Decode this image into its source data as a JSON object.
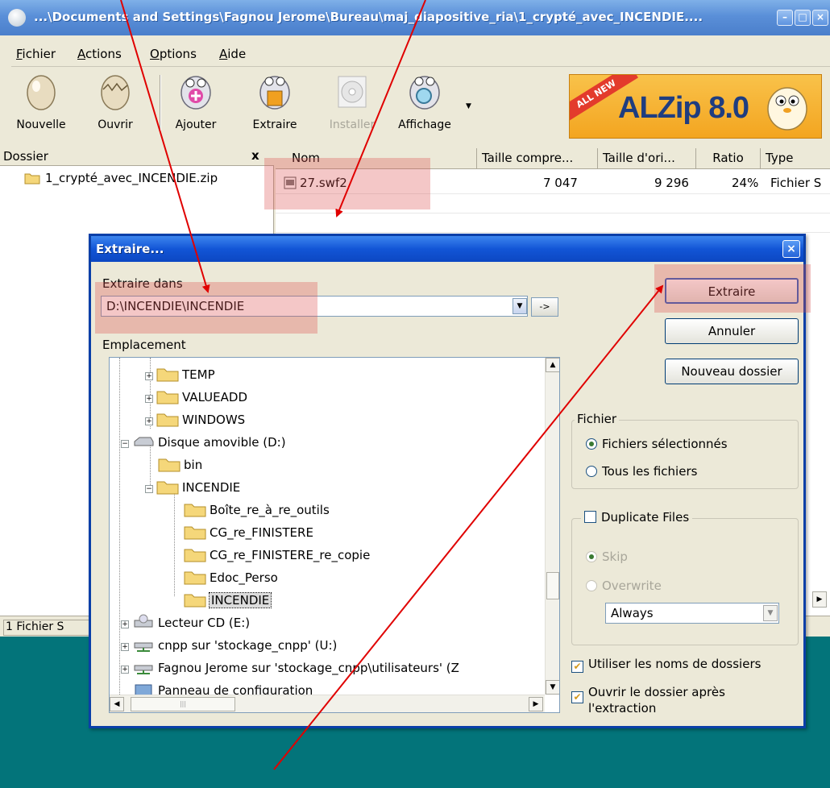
{
  "window": {
    "title": "...\\Documents and Settings\\Fagnou Jerome\\Bureau\\maj_diapositive_ria\\1_crypté_avec_INCENDIE...."
  },
  "menu": [
    "Fichier",
    "Actions",
    "Options",
    "Aide"
  ],
  "toolbar": {
    "buttons": [
      {
        "label": "Nouvelle",
        "icon": "egg-icon"
      },
      {
        "label": "Ouvrir",
        "icon": "cracked-egg-icon"
      },
      {
        "label": "Ajouter",
        "icon": "mascot-add-icon"
      },
      {
        "label": "Extraire",
        "icon": "mascot-extract-icon"
      },
      {
        "label": "Installer",
        "icon": "install-cd-icon",
        "disabled": true
      },
      {
        "label": "Affichage",
        "icon": "mascot-view-icon"
      }
    ],
    "banner": {
      "ribbon": "ALL NEW",
      "brand": "ALZip 8.0"
    }
  },
  "folder_panel": {
    "header": "Dossier",
    "close": "x",
    "items": [
      "1_crypté_avec_INCENDIE.zip"
    ]
  },
  "file_list": {
    "columns": [
      "Nom",
      "Taille compre...",
      "Taille d'ori...",
      "Ratio",
      "Type"
    ],
    "rows": [
      {
        "name": "27.swf2",
        "compressed": "7 047",
        "original": "9 296",
        "ratio": "24%",
        "type": "Fichier S"
      }
    ]
  },
  "statusbar": {
    "text": "1 Fichier S"
  },
  "dialog": {
    "title": "Extraire...",
    "close": "×",
    "extract_label": "Extraire dans",
    "path_value": "D:\\INCENDIE\\INCENDIE",
    "go_button": "->",
    "emplacement_label": "Emplacement",
    "tree": [
      {
        "label": "TEMP"
      },
      {
        "label": "VALUEADD"
      },
      {
        "label": "WINDOWS"
      },
      {
        "label": "Disque amovible (D:)"
      },
      {
        "label": "bin"
      },
      {
        "label": "INCENDIE"
      },
      {
        "label": "Boîte_re_à_re_outils"
      },
      {
        "label": "CG_re_FINISTERE"
      },
      {
        "label": "CG_re_FINISTERE_re_copie"
      },
      {
        "label": "Edoc_Perso"
      },
      {
        "label": "INCENDIE"
      },
      {
        "label": "Lecteur CD (E:)"
      },
      {
        "label": "cnpp sur 'stockage_cnpp' (U:)"
      },
      {
        "label": "Fagnou Jerome sur 'stockage_cnpp\\utilisateurs' (Z"
      },
      {
        "label": "Panneau de configuration"
      }
    ],
    "buttons": {
      "extract": "Extraire",
      "cancel": "Annuler",
      "new_folder": "Nouveau dossier"
    },
    "fichier_group": {
      "legend": "Fichier",
      "options": [
        "Fichiers sélectionnés",
        "Tous les fichiers"
      ],
      "selected": 0
    },
    "duplicate_group": {
      "legend": "Duplicate Files",
      "options": [
        "Skip",
        "Overwrite"
      ],
      "selected": 0,
      "combo_value": "Always"
    },
    "checks": {
      "use_folder_names": "Utiliser les noms de dossiers",
      "open_after_line1": "Ouvrir le dossier après",
      "open_after_line2": "l'extraction"
    }
  },
  "colors": {
    "desktop": "#03747a",
    "highlight": "#dc5050",
    "annotation_arrow": "#e00000",
    "dialog_title": "#1255d6"
  }
}
